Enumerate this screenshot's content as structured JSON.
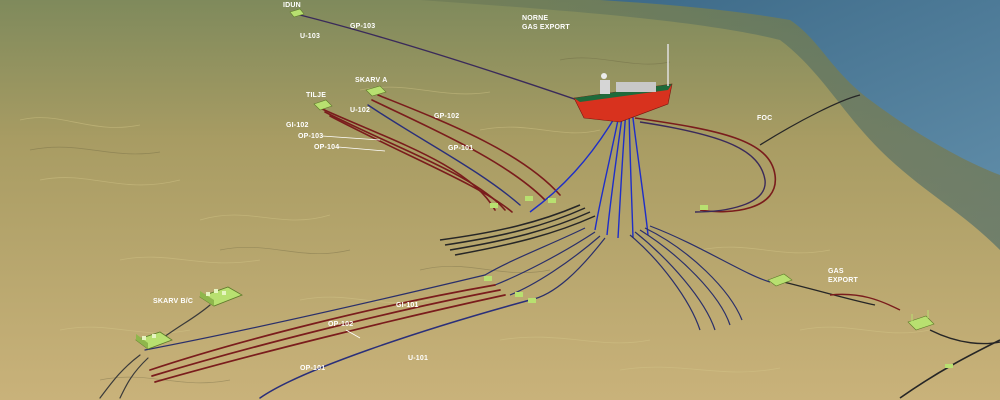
{
  "labels": {
    "idun": "IDUN",
    "gp103": "GP-103",
    "u103": "U-103",
    "norne_line1": "NORNE",
    "norne_line2": "GAS EXPORT",
    "skarv_a": "SKARV A",
    "tilje": "TILJE",
    "u102": "U-102",
    "gi102": "GI-102",
    "op103": "OP-103",
    "op104": "OP-104",
    "gp102": "GP-102",
    "gp101": "GP-101",
    "foc": "FOC",
    "gas_line1": "GAS",
    "gas_line2": "EXPORT",
    "skarv_bc": "SKARV B/C",
    "gi101": "GI-101",
    "op102": "OP-102",
    "op101": "OP-101",
    "u101": "U-101"
  },
  "colors": {
    "seabed": "#b7a665",
    "sea": "#4f7e9a",
    "production_line": "#7a1c1c",
    "control_line": "#2a2f7a",
    "riser": "#1e2ec8",
    "vessel_hull": "#d8321e",
    "template": "#b8e070"
  }
}
